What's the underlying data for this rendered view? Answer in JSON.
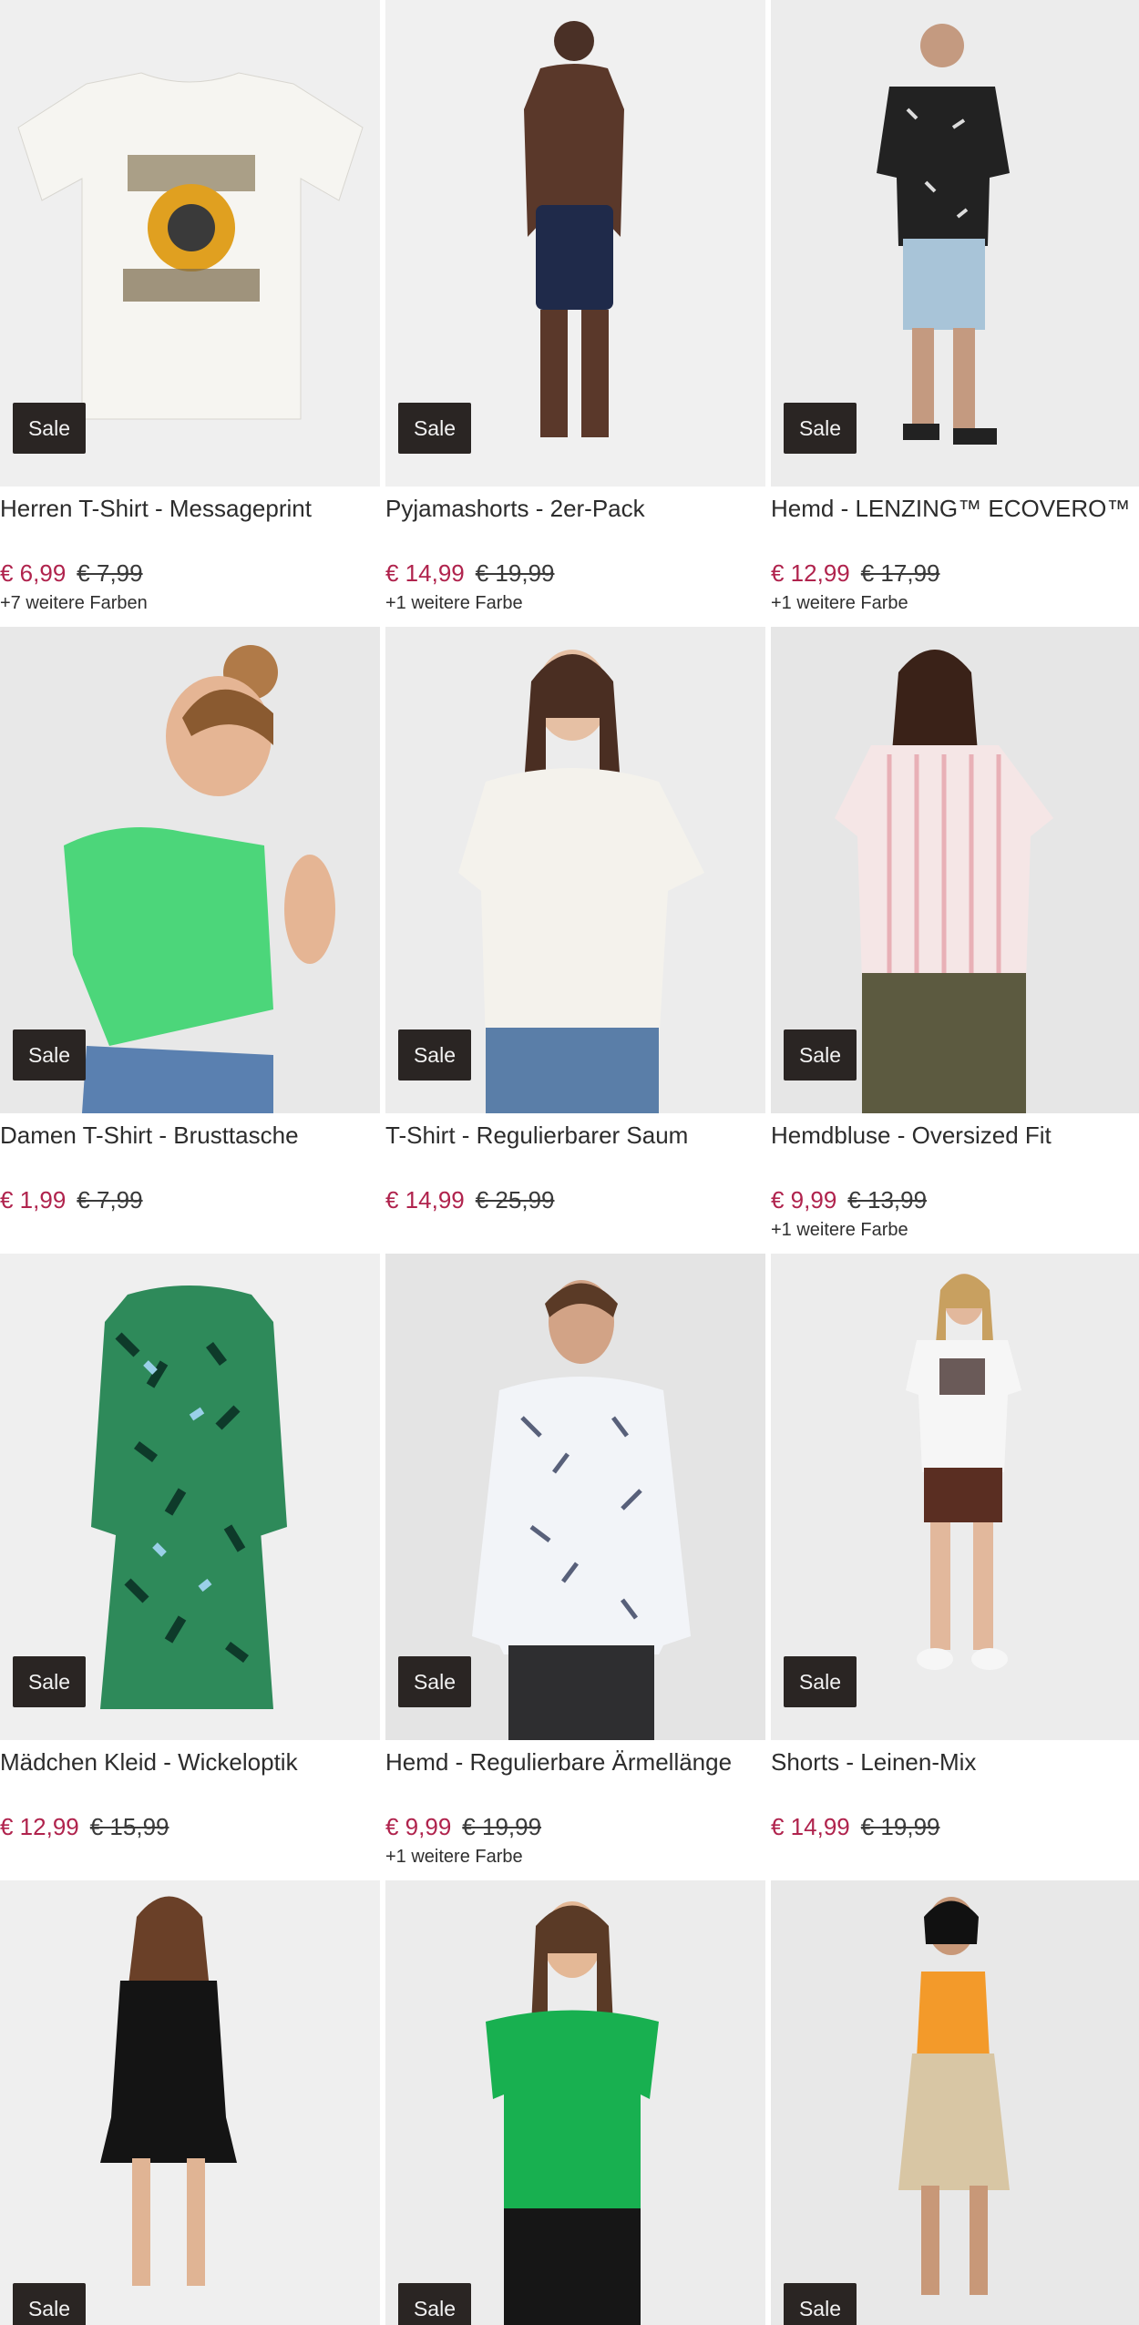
{
  "badge_label": "Sale",
  "products": [
    {
      "title": "Herren T-Shirt - Messageprint",
      "price": "€ 6,99",
      "old_price": "€ 7,99",
      "colors": "+7 weitere Farben",
      "image": "white t-shirt with skull print"
    },
    {
      "title": "Pyjamashorts - 2er-Pack",
      "price": "€ 14,99",
      "old_price": "€ 19,99",
      "colors": "+1 weitere Farbe",
      "image": "man in navy shorts"
    },
    {
      "title": "Hemd - LENZING™ ECOVERO™",
      "price": "€ 12,99",
      "old_price": "€ 17,99",
      "colors": "+1 weitere Farbe",
      "image": "man in bandana print shirt"
    },
    {
      "title": "Damen T-Shirt - Brusttasche",
      "price": "€ 1,99",
      "old_price": "€ 7,99",
      "colors": "",
      "image": "woman in green t-shirt"
    },
    {
      "title": "T-Shirt - Regulierbarer Saum",
      "price": "€ 14,99",
      "old_price": "€ 25,99",
      "colors": "",
      "image": "woman in white top"
    },
    {
      "title": "Hemdbluse - Oversized Fit",
      "price": "€ 9,99",
      "old_price": "€ 13,99",
      "colors": "+1 weitere Farbe",
      "image": "woman in striped blouse"
    },
    {
      "title": "Mädchen Kleid - Wickeloptik",
      "price": "€ 12,99",
      "old_price": "€ 15,99",
      "colors": "",
      "image": "green patterned dress"
    },
    {
      "title": "Hemd - Regulierbare Ärmellänge",
      "price": "€ 9,99",
      "old_price": "€ 19,99",
      "colors": "+1 weitere Farbe",
      "image": "man in leaf print shirt"
    },
    {
      "title": "Shorts - Leinen-Mix",
      "price": "€ 14,99",
      "old_price": "€ 19,99",
      "colors": "",
      "image": "woman in brown shorts"
    },
    {
      "title": "",
      "price": "",
      "old_price": "",
      "colors": "",
      "image": "woman in black dress"
    },
    {
      "title": "",
      "price": "",
      "old_price": "",
      "colors": "",
      "image": "woman in green t-shirt"
    },
    {
      "title": "",
      "price": "",
      "old_price": "",
      "colors": "",
      "image": "woman in orange top and beige skirt"
    }
  ]
}
